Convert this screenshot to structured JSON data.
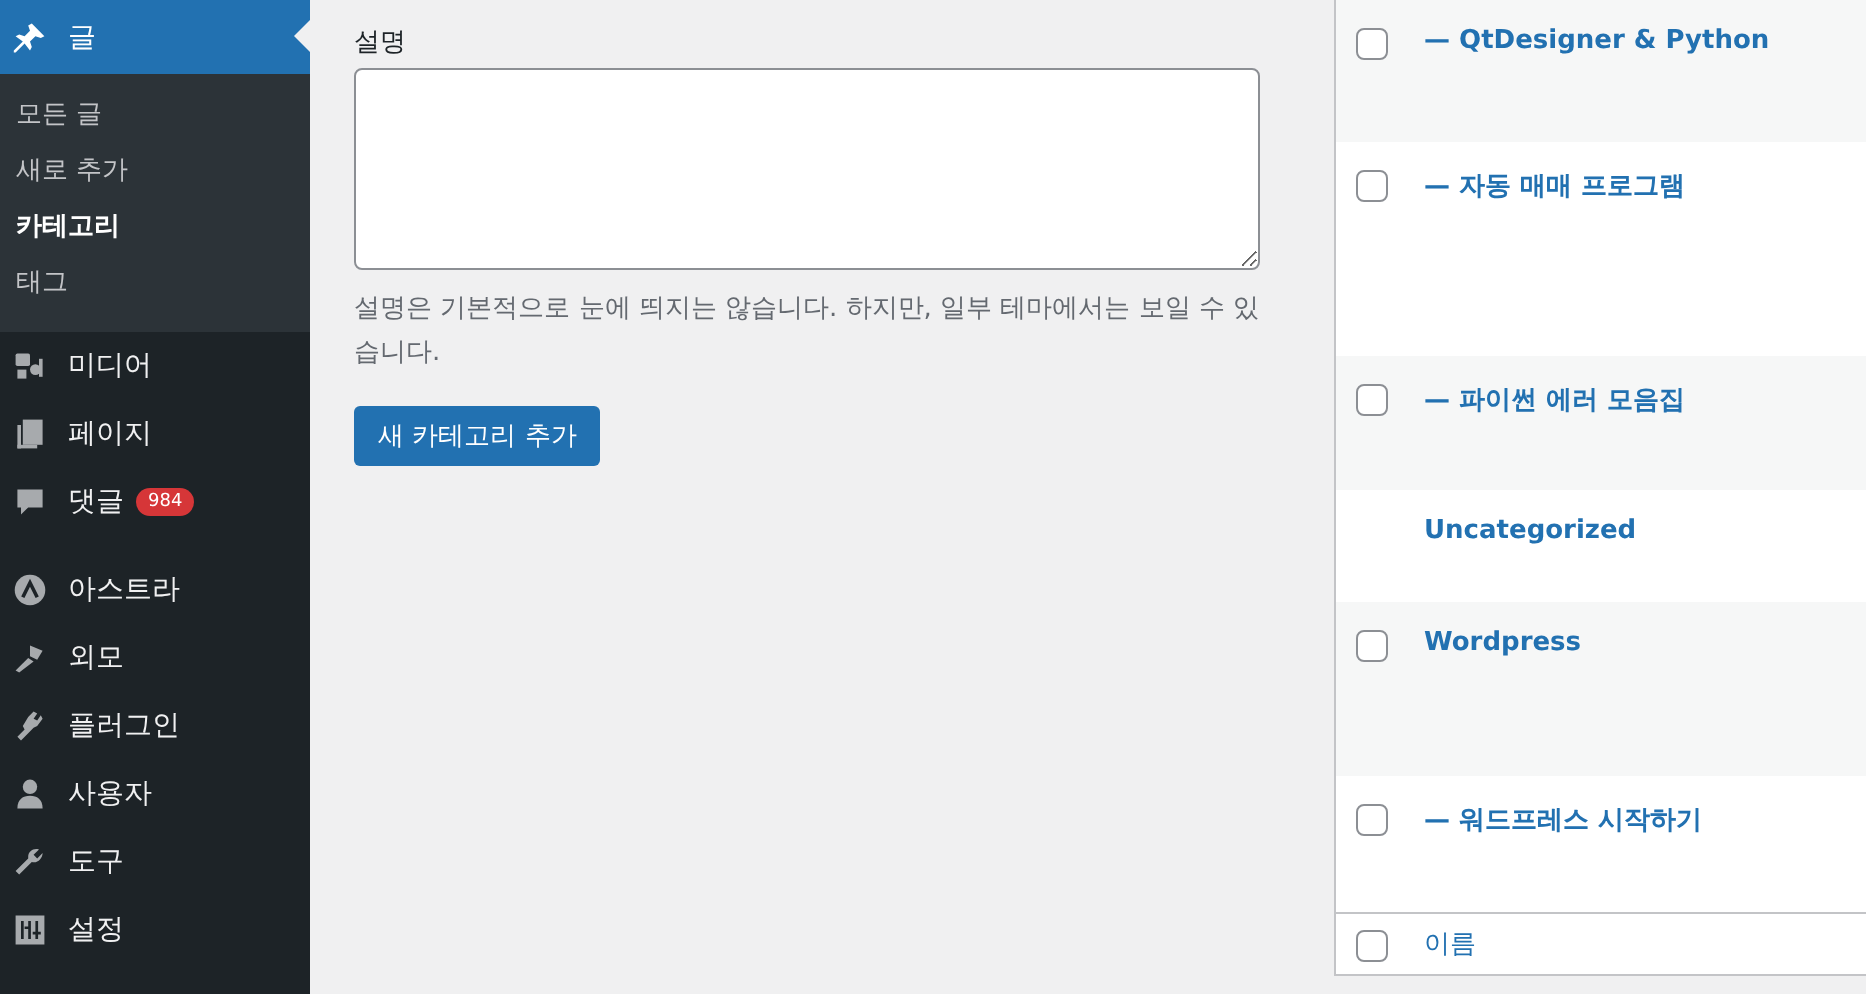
{
  "sidebar": {
    "items": [
      {
        "label": "글",
        "selected": true,
        "children": [
          {
            "label": "모든 글",
            "selected": false
          },
          {
            "label": "새로 추가",
            "selected": false
          },
          {
            "label": "카테고리",
            "selected": true
          },
          {
            "label": "태그",
            "selected": false
          }
        ]
      },
      {
        "label": "미디어",
        "selected": false
      },
      {
        "label": "페이지",
        "selected": false
      },
      {
        "label": "댓글",
        "selected": false,
        "badge": "984"
      },
      {
        "label": "아스트라",
        "selected": false,
        "separated": true
      },
      {
        "label": "외모",
        "selected": false
      },
      {
        "label": "플러그인",
        "selected": false
      },
      {
        "label": "사용자",
        "selected": false
      },
      {
        "label": "도구",
        "selected": false
      },
      {
        "label": "설정",
        "selected": false
      }
    ]
  },
  "form": {
    "label": "설명",
    "help": "설명은 기본적으로 눈에 띄지는 않습니다. 하지만, 일부 테마에서는 보일 수 있습니다.",
    "button": "새 카테고리 추가"
  },
  "table": {
    "rows": [
      {
        "name": "— QtDesigner & Python",
        "checked": false
      },
      {
        "name": "— 자동 매매 프로그램",
        "checked": false
      },
      {
        "name": "— 파이썬 에러 모음집",
        "checked": false
      },
      {
        "name": "Uncategorized"
      },
      {
        "name": "Wordpress",
        "checked": false
      },
      {
        "name": "— 워드프레스 시작하기",
        "checked": false
      }
    ],
    "footer": {
      "label": "이름",
      "checked": false
    }
  }
}
